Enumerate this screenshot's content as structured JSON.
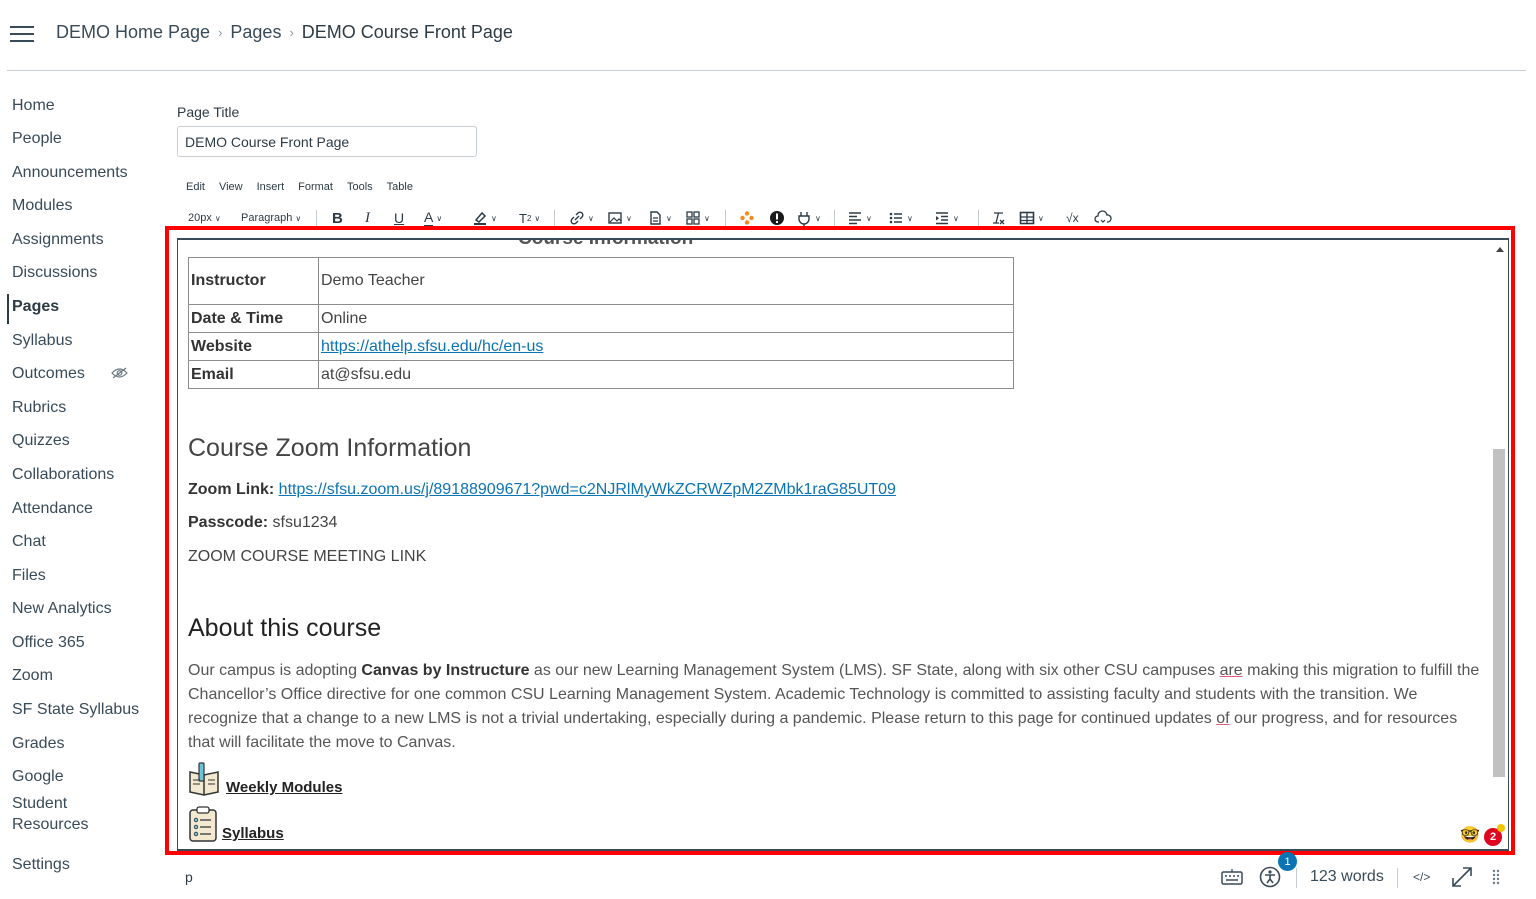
{
  "header": {
    "breadcrumb": [
      "DEMO Home Page",
      "Pages",
      "DEMO Course Front Page"
    ]
  },
  "sidebar": {
    "items": [
      "Home",
      "People",
      "Announcements",
      "Modules",
      "Assignments",
      "Discussions",
      "Pages",
      "Syllabus",
      "Outcomes",
      "Rubrics",
      "Quizzes",
      "Collaborations",
      "Attendance",
      "Chat",
      "Files",
      "New Analytics",
      "Office 365",
      "Zoom",
      "SF State Syllabus",
      "Grades",
      "Google",
      "Student Resources",
      "Settings"
    ],
    "active": "Pages",
    "hidden_indicator_item": "Outcomes"
  },
  "title_field": {
    "label": "Page Title",
    "value": "DEMO Course Front Page"
  },
  "editor": {
    "menubar": [
      "Edit",
      "View",
      "Insert",
      "Format",
      "Tools",
      "Table"
    ],
    "toolbar": {
      "font_size": "20px",
      "block_format": "Paragraph",
      "icons": [
        "bold-icon",
        "italic-icon",
        "underline-icon",
        "text-color-icon",
        "highlight-icon",
        "superscript-icon",
        "link-icon",
        "image-icon",
        "document-icon",
        "media-icon",
        "apps-icon",
        "accessibility-checker-icon",
        "plugin-icon",
        "align-icon",
        "bullet-list-icon",
        "indent-icon",
        "clear-formatting-icon",
        "table-icon",
        "equation-icon",
        "embed-icon"
      ]
    },
    "content": {
      "cut_off_heading": "Course Information",
      "info_table": [
        {
          "label": "Instructor",
          "value": "Demo Teacher"
        },
        {
          "label": "Date & Time",
          "value": "Online"
        },
        {
          "label": "Website",
          "value": "https://athelp.sfsu.edu/hc/en-us"
        },
        {
          "label": "Email",
          "value": "at@sfsu.edu"
        }
      ],
      "zoom_heading": "Course Zoom Information",
      "zoom_link_label": "Zoom Link:",
      "zoom_link": "https://sfsu.zoom.us/j/89188909671?pwd=c2NJRlMyWkZCRWZpM2ZMbk1raG85UT09",
      "passcode_label": "Passcode:",
      "passcode": "sfsu1234",
      "meeting_link_text": "ZOOM COURSE MEETING LINK",
      "about_heading": "About this course",
      "about": {
        "p1": "Our campus is adopting ",
        "bold": "Canvas by Instructure",
        "p2": " as our new Learning Management System (LMS). SF State, along with six other CSU campuses ",
        "are": "are",
        "p3": " making this migration to fulfill the Chancellor’s Office directive for one common CSU Learning Management System. Academic Technology is committed to assisting faculty and students with the transition. We recognize that a change to a new LMS is not a trivial undertaking, especially during a pandemic. Please return to this page for continued updates ",
        "of": "of",
        "p4": " our progress, and for resources that will facilitate the move to Canvas."
      },
      "links": [
        {
          "label": "Weekly Modules",
          "icon": "book-icon"
        },
        {
          "label": "Syllabus",
          "icon": "clipboard-icon"
        }
      ]
    },
    "notification_count": "2"
  },
  "status_bar": {
    "path": "p",
    "accessibility_issues": "1",
    "word_count": "123 words",
    "html_toggle": "</>"
  },
  "colors": {
    "highlight_frame": "#ff0000",
    "link": "#0b74b3",
    "badge": "#e0061f"
  }
}
